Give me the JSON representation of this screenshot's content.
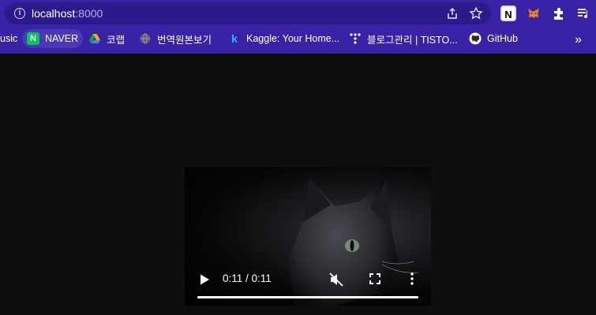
{
  "browser": {
    "url_host": "localhost",
    "url_port": ":8000",
    "icons": [
      "info-icon",
      "share-icon",
      "star-icon",
      "notion-icon",
      "metamask-icon",
      "extensions-icon",
      "reading-list-icon"
    ]
  },
  "bookmarks": {
    "items": [
      {
        "label": "usic"
      },
      {
        "label": "NAVER",
        "icon_text": "N",
        "icon_color": "#03c75a"
      },
      {
        "label": "코랩",
        "icon_color": "#f9ab00"
      },
      {
        "label": "번역원본보기"
      },
      {
        "label": "Kaggle: Your Home...",
        "icon_text": "k",
        "icon_color": "#20beff"
      },
      {
        "label": "블로그관리 | TISTO..."
      },
      {
        "label": "GitHub"
      }
    ],
    "more": "»"
  },
  "video": {
    "time_display": "0:11 / 0:11",
    "progress": 1.0,
    "muted": true
  }
}
